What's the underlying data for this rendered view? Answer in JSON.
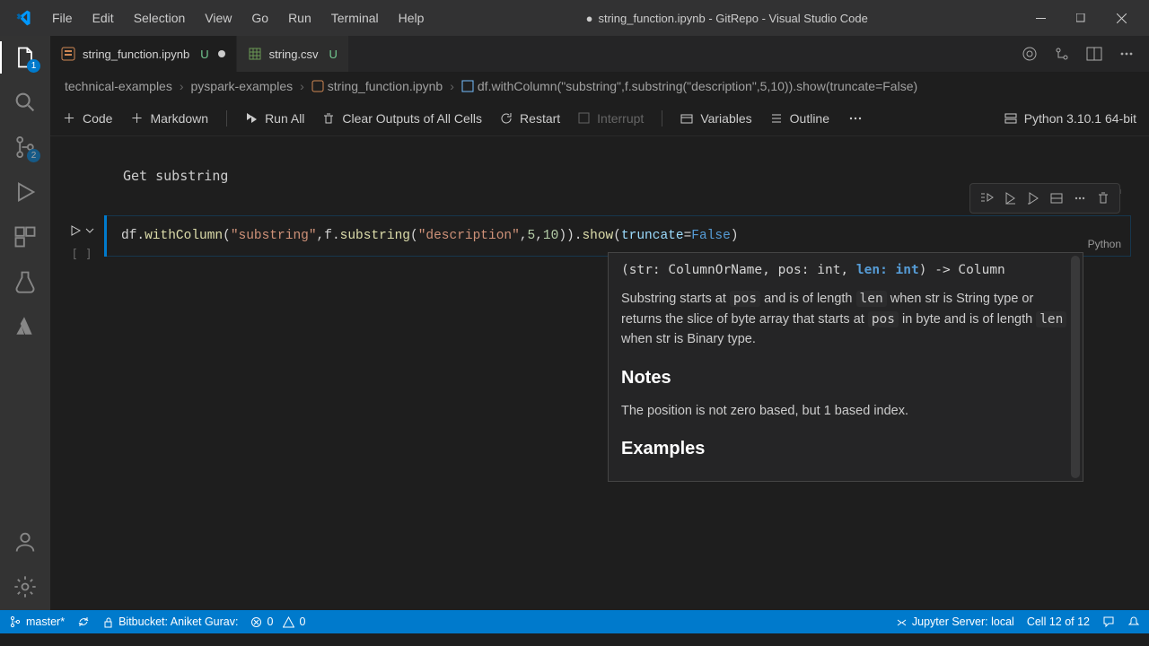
{
  "menu": {
    "file": "File",
    "edit": "Edit",
    "selection": "Selection",
    "view": "View",
    "go": "Go",
    "run": "Run",
    "terminal": "Terminal",
    "help": "Help"
  },
  "title_prefix": "●",
  "title": "string_function.ipynb - GitRepo - Visual Studio Code",
  "activity": {
    "explorer_badge": "1",
    "scm_badge": "2"
  },
  "tabs": {
    "t1": {
      "name": "string_function.ipynb",
      "status": "U"
    },
    "t2": {
      "name": "string.csv",
      "status": "U"
    }
  },
  "breadcrumbs": {
    "p1": "technical-examples",
    "p2": "pyspark-examples",
    "p3": "string_function.ipynb",
    "p4": "df.withColumn(\"substring\",f.substring(\"description\",5,10)).show(truncate=False)"
  },
  "nbtoolbar": {
    "code": "Code",
    "markdown": "Markdown",
    "runall": "Run All",
    "clear": "Clear Outputs of All Cells",
    "restart": "Restart",
    "interrupt": "Interrupt",
    "variables": "Variables",
    "outline": "Outline",
    "kernel": "Python 3.10.1 64-bit"
  },
  "cells": {
    "md1": {
      "text": "Get substring",
      "lang": "Markdown"
    },
    "code1": {
      "prompt": "[ ]",
      "lang": "Python",
      "tokens": {
        "t0": "df.",
        "t1": "withColumn",
        "t2": "(",
        "t3": "\"substring\"",
        "t4": ",f.",
        "t5": "substring",
        "t6": "(",
        "t7": "\"description\"",
        "t8": ",",
        "t9": "5",
        "t10": ",",
        "t11": "10",
        "t12": ")).",
        "t13": "show",
        "t14": "(",
        "t15": "truncate",
        "t16": "=",
        "t17": "False",
        "t18": ")"
      }
    }
  },
  "hover": {
    "sig": {
      "pre": "(str: ColumnOrName, pos: int, ",
      "active": "len: int",
      "post": ") -> Column"
    },
    "body1a": "Substring starts at ",
    "body1b": "pos",
    "body1c": " and is of length ",
    "body1d": "len",
    "body1e": " when str is String type or returns the slice of byte array that starts at ",
    "body1f": "pos",
    "body1g": " in byte and is of length ",
    "body1h": "len",
    "body1i": " when str is Binary type.",
    "h_notes": "Notes",
    "body2": "The position is not zero based, but 1 based index.",
    "h_examples": "Examples"
  },
  "status": {
    "branch": "master*",
    "bitbucket": "Bitbucket: Aniket Gurav:",
    "errors": "0",
    "warnings": "0",
    "jupyter": "Jupyter Server: local",
    "cell": "Cell 12 of 12"
  }
}
